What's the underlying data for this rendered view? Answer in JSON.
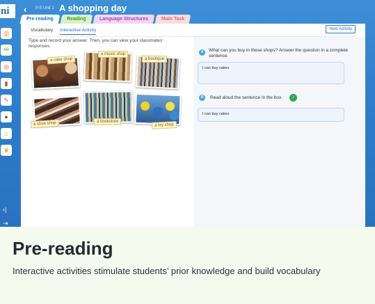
{
  "header": {
    "back_icon": "chevron-left-icon",
    "unit_label": "P-5 Unit 1",
    "title": "A shopping day"
  },
  "logo": {
    "text": "ni"
  },
  "stage_tabs": [
    {
      "label": "Pre-reading",
      "color": "#1f6fc2"
    },
    {
      "label": "Reading",
      "color": "#3f9b23"
    },
    {
      "label": "Language Structures",
      "color": "#a448b4"
    },
    {
      "label": "Main Task",
      "color": "#d86b78"
    }
  ],
  "sub_tabs": [
    {
      "label": "Vocabulary"
    },
    {
      "label": "Interactive Activity",
      "active": true
    }
  ],
  "next_button": "Next Activity",
  "instructions": "Type and record your answer. Then, you can view your classmates' responses.",
  "shop_labels": [
    "a cake shop",
    "a music shop",
    "a boutique",
    "a shoe shop",
    "a bookstore",
    "a toy shop"
  ],
  "question_a": {
    "badge": "A",
    "text": "What can you buy in these shops? Answer the question in a complete sentence.",
    "answer": "I can buy cakes"
  },
  "question_b": {
    "badge": "B",
    "text": "Read aloud the sentence in the box.",
    "answer": "I can buy cakes",
    "icon": "speaker-icon"
  },
  "left_rail_icons": [
    "book-icon",
    "abc-icon",
    "target-icon",
    "notebook-icon",
    "pen-icon",
    "speech-icon",
    "house-icon",
    "trophy-icon"
  ],
  "caption": {
    "title": "Pre-reading",
    "text": "Interactive activities stimulate students’ prior knowledge and build vocabulary"
  },
  "colors": {
    "accent": "#1f6fc2",
    "caption_bg": "#f4fbee",
    "sky": "#2f7fcc"
  }
}
